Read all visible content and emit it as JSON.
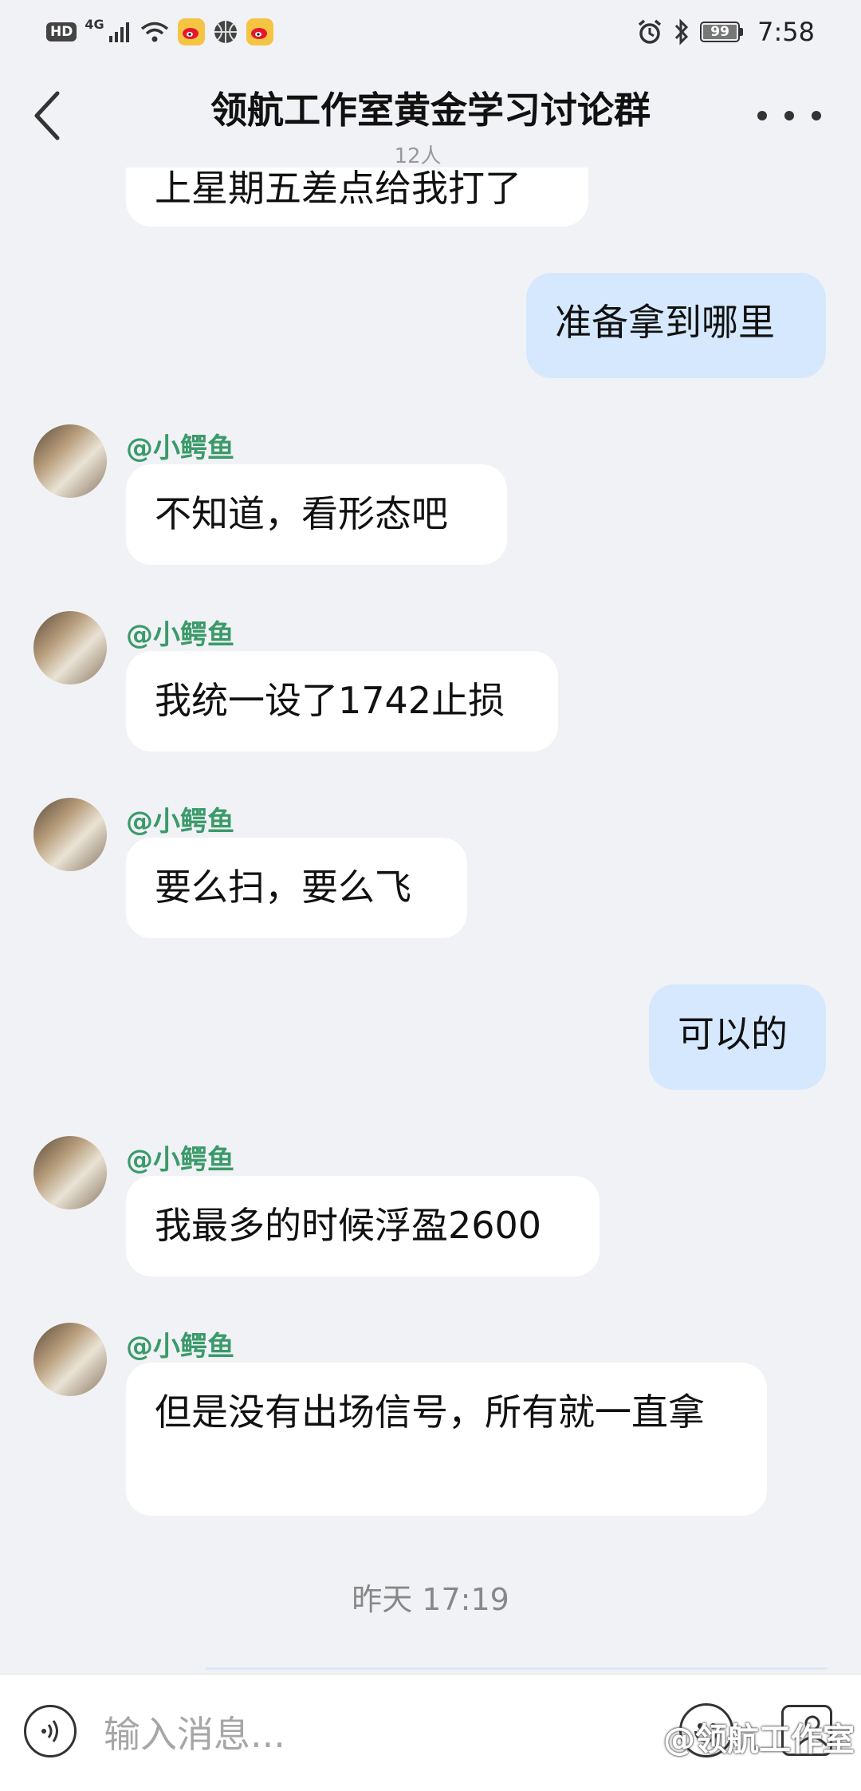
{
  "status_bar": {
    "hd": "HD",
    "network": "4G",
    "battery": "99",
    "time": "7:58"
  },
  "header": {
    "title": "领航工作室黄金学习讨论群",
    "member_count": "12人"
  },
  "messages": [
    {
      "dir": "in",
      "text": "上星期五差点给我打了"
    },
    {
      "dir": "out",
      "text": "准备拿到哪里"
    },
    {
      "dir": "in",
      "sender": "@小鳄鱼",
      "text": "不知道，看形态吧"
    },
    {
      "dir": "in",
      "sender": "@小鳄鱼",
      "text": "我统一设了1742止损"
    },
    {
      "dir": "in",
      "sender": "@小鳄鱼",
      "text": "要么扫，要么飞"
    },
    {
      "dir": "out",
      "text": "可以的"
    },
    {
      "dir": "in",
      "sender": "@小鳄鱼",
      "text": "我最多的时候浮盈2600"
    },
    {
      "dir": "in",
      "sender": "@小鳄鱼",
      "text": "但是没有出场信号，所有就一直拿"
    }
  ],
  "timestamp": "昨天 17:19",
  "input": {
    "placeholder": "输入消息..."
  },
  "watermark": "@领航工作室",
  "colors": {
    "background": "#f1f2f5",
    "outgoing_bubble": "#d5e8fd",
    "incoming_bubble": "#ffffff",
    "sender_name": "#3a9a6a"
  },
  "icons": [
    "hd-icon",
    "signal-icon",
    "wifi-icon",
    "weibo-icon",
    "basketball-icon",
    "alarm-icon",
    "bluetooth-icon",
    "battery-icon",
    "back-arrow-icon",
    "more-icon",
    "voice-icon",
    "emoji-icon",
    "image-icon"
  ]
}
